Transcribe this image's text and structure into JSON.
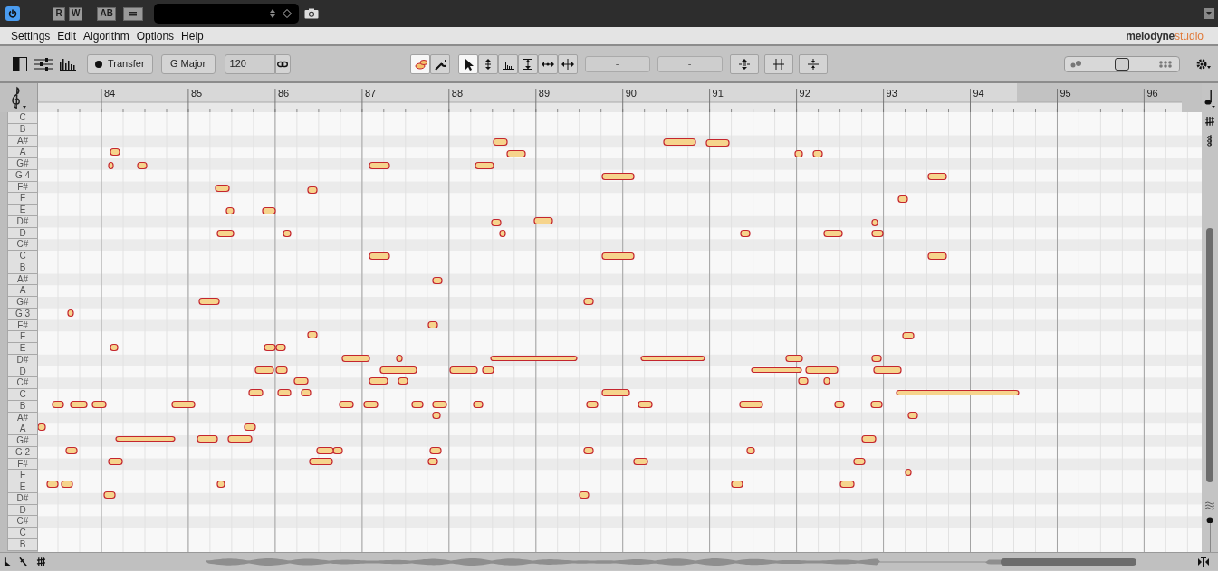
{
  "top_bar": {
    "power": {
      "on": true
    },
    "buttons": [
      {
        "label": "R"
      },
      {
        "label": "W"
      },
      {
        "label": "AB"
      }
    ]
  },
  "menu": [
    "Settings",
    "Edit",
    "Algorithm",
    "Options",
    "Help"
  ],
  "logo": {
    "brand": "melodyne",
    "edition": "studio"
  },
  "toolbar": {
    "transfer": "Transfer",
    "scale": "G Major",
    "tempo": "120",
    "view_tools": [
      {
        "kind": "blob",
        "selected": true
      },
      {
        "kind": "wrench",
        "selected": false
      }
    ],
    "edit_tools": [
      {
        "kind": "pointer",
        "selected": true
      },
      {
        "kind": "pitch",
        "selected": false
      },
      {
        "kind": "formant",
        "selected": false
      },
      {
        "kind": "amplitude",
        "selected": false
      },
      {
        "kind": "time",
        "selected": false
      },
      {
        "kind": "split",
        "selected": false
      }
    ],
    "fields": [
      "-",
      "-"
    ],
    "zoom": {
      "level": 0.5
    }
  },
  "ruler": {
    "bars": [
      "84",
      "85",
      "86",
      "87",
      "88",
      "89",
      "90",
      "91",
      "92",
      "93",
      "94",
      "95",
      "96"
    ]
  },
  "pitch_rows": [
    {
      "label": "C",
      "black_key": false
    },
    {
      "label": "B",
      "black_key": false
    },
    {
      "label": "A#",
      "black_key": true
    },
    {
      "label": "A",
      "black_key": false
    },
    {
      "label": "G#",
      "black_key": true
    },
    {
      "label": "G 4",
      "black_key": false
    },
    {
      "label": "F#",
      "black_key": true
    },
    {
      "label": "F",
      "black_key": false
    },
    {
      "label": "E",
      "black_key": false
    },
    {
      "label": "D#",
      "black_key": true
    },
    {
      "label": "D",
      "black_key": false
    },
    {
      "label": "C#",
      "black_key": true
    },
    {
      "label": "C",
      "black_key": false
    },
    {
      "label": "B",
      "black_key": false
    },
    {
      "label": "A#",
      "black_key": true
    },
    {
      "label": "A",
      "black_key": false
    },
    {
      "label": "G#",
      "black_key": true
    },
    {
      "label": "G 3",
      "black_key": false
    },
    {
      "label": "F#",
      "black_key": true
    },
    {
      "label": "F",
      "black_key": false
    },
    {
      "label": "E",
      "black_key": false
    },
    {
      "label": "D#",
      "black_key": true
    },
    {
      "label": "D",
      "black_key": false
    },
    {
      "label": "C#",
      "black_key": true
    },
    {
      "label": "C",
      "black_key": false
    },
    {
      "label": "B",
      "black_key": false
    },
    {
      "label": "A#",
      "black_key": true
    },
    {
      "label": "A",
      "black_key": false
    },
    {
      "label": "G#",
      "black_key": true
    },
    {
      "label": "G 2",
      "black_key": false
    },
    {
      "label": "F#",
      "black_key": true
    },
    {
      "label": "F",
      "black_key": false
    },
    {
      "label": "E",
      "black_key": false
    },
    {
      "label": "D#",
      "black_key": true
    },
    {
      "label": "D",
      "black_key": false
    },
    {
      "label": "C#",
      "black_key": true
    },
    {
      "label": "C",
      "black_key": false
    },
    {
      "label": "B",
      "black_key": false
    }
  ]
}
